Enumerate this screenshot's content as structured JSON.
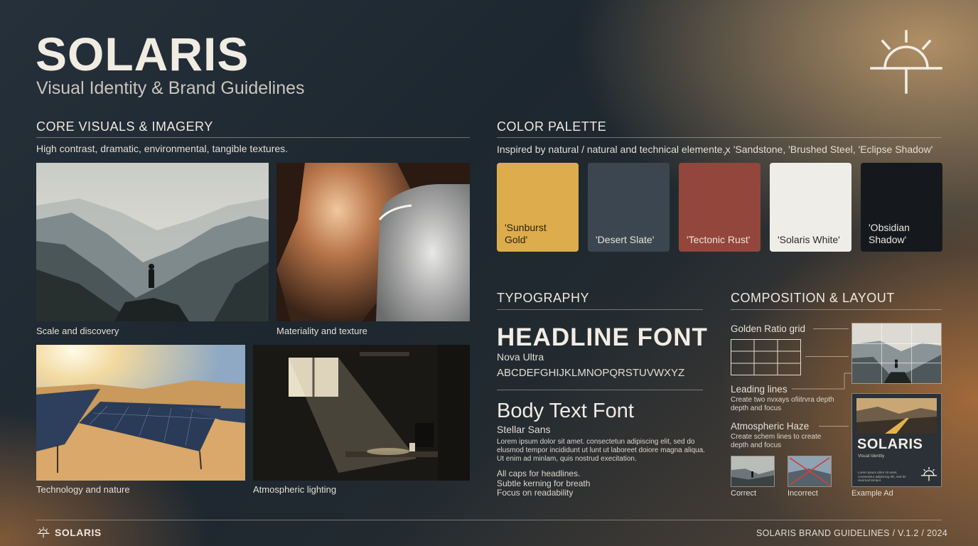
{
  "header": {
    "title": "SOLARIS",
    "subtitle": "Visual Identity & Brand Guidelines",
    "logo_icon": "rising-sun-icon"
  },
  "core_visuals": {
    "title": "CORE VISUALS & IMAGERY",
    "description": "High contrast, dramatic, environmental, tangible textures.",
    "images": [
      {
        "caption": "Scale and discovery"
      },
      {
        "caption": "Materiality and texture"
      },
      {
        "caption": "Technology and nature"
      },
      {
        "caption": "Atmospheric lighting"
      }
    ]
  },
  "color_palette": {
    "title": "COLOR PALETTE",
    "description": "Inspired by natural / natural and technical elemente.ꭗ 'Sandstone, 'Brushed Steel, 'Eclipse Shadow'",
    "swatches": [
      {
        "name": "'Sunburst Gold'",
        "color": "#ddac4c",
        "text_color": "#2a2216"
      },
      {
        "name": "'Desert Slate'",
        "color": "#3b4650",
        "text_color": "#e8e3da"
      },
      {
        "name": "'Tectonic Rust'",
        "color": "#93463c",
        "text_color": "#efe4da"
      },
      {
        "name": "'Solaris White'",
        "color": "#efede8",
        "text_color": "#2a2a2a"
      },
      {
        "name": "'Obsidian Shadow'",
        "color": "#15191e",
        "text_color": "#ece6dc"
      }
    ]
  },
  "typography": {
    "title": "TYPOGRAPHY",
    "headline_sample": "HEADLINE FONT",
    "headline_name": "Nova Ultra",
    "alphabet": "ABCDEFGHIJKLMNOPQRSTUVWXYZ",
    "body_sample": "Body Text Font",
    "body_name": "Stellar Sans",
    "lorem": "Lorem ipsum dolor sit amet. consectetun adipiscing elit, sed do elusmod tempor incididunt ut lunt ut laboreet doiore magna aliqua. Ut enim ad minlam, quis nostrud execitation.",
    "tips": [
      "All caps for headlines.",
      "Subtle kerning for breath",
      "Focus on readability"
    ]
  },
  "composition": {
    "title": "COMPOSITION & LAYOUT",
    "golden_ratio": "Golden Ratio grid",
    "leading_lines": "Leading lines",
    "leading_lines_desc": "Create two nvxays ofiitrvra depth depth and focus",
    "atmospheric_haze": "Atmospheric Haze",
    "atmospheric_haze_desc": "Create schem lines to create depth and focus",
    "correct": "Correct",
    "incorrect": "Incorrect",
    "example_ad": "Example Ad",
    "ad_title": "SOLARIS",
    "ad_subtitle": "Visual Identity",
    "ad_body": "Lorem ipsum dolor sit amet, consectetur adipiscing elit, sed do eiusmod tempor."
  },
  "footer": {
    "logo": "SOLARIS",
    "right": "SOLARIS BRAND GUIDELINES / V.1.2 / 2024"
  }
}
